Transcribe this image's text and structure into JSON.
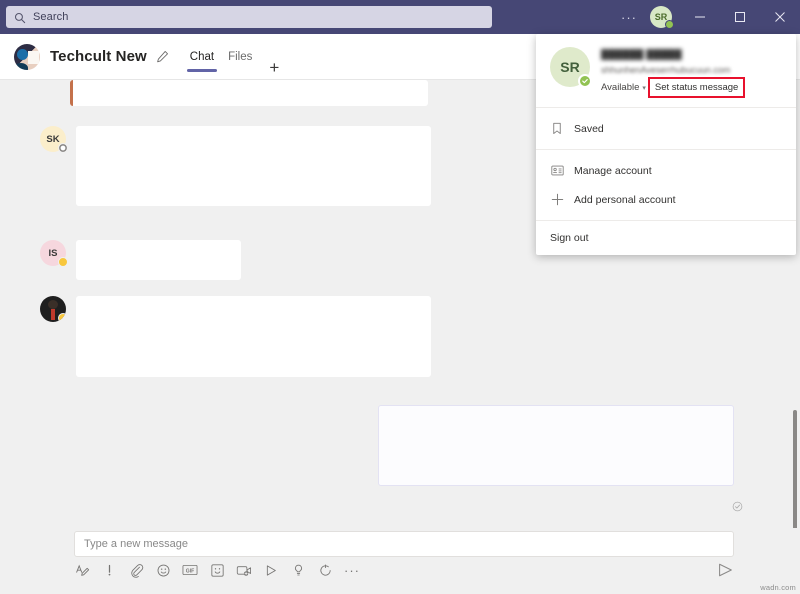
{
  "titlebar": {
    "search_placeholder": "Search",
    "search_icon": "search-icon",
    "more_label": "···",
    "avatar_initials": "SR",
    "presence": "Available",
    "minimize_label": "Minimize",
    "maximize_label": "Maximize",
    "close_label": "Close",
    "accent_color": "#464775"
  },
  "channel": {
    "title": "Techcult New",
    "edit_label": "Edit",
    "tabs": [
      {
        "label": "Chat",
        "active": true
      },
      {
        "label": "Files",
        "active": false
      }
    ],
    "add_tab_label": "+"
  },
  "messages": [
    {
      "sender_initials": "",
      "bubble": "urgent",
      "status": ""
    },
    {
      "sender_initials": "SK",
      "avatar_color": "#fbeecb",
      "status": "offline",
      "status_color": "#8a8886"
    },
    {
      "sender_initials": "IS",
      "avatar_color": "#f6d7de",
      "status": "away",
      "status_color": "#f8c73d"
    },
    {
      "sender_initials": "",
      "avatar_color": "#1f1f1f",
      "status": "away",
      "status_color": "#f8c73d"
    }
  ],
  "outgoing": {
    "seen_icon": "seen-check-icon"
  },
  "compose": {
    "placeholder": "Type a new message",
    "value": "",
    "tools": [
      {
        "name": "format-icon",
        "label": "Format"
      },
      {
        "name": "importance-icon",
        "label": "Set delivery options"
      },
      {
        "name": "attach-icon",
        "label": "Attach"
      },
      {
        "name": "emoji-icon",
        "label": "Emoji"
      },
      {
        "name": "giphy-icon",
        "label": "Giphy"
      },
      {
        "name": "sticker-icon",
        "label": "Sticker"
      },
      {
        "name": "meet-now-icon",
        "label": "Meet now"
      },
      {
        "name": "stream-icon",
        "label": "Stream"
      },
      {
        "name": "praise-icon",
        "label": "Praise"
      },
      {
        "name": "approvals-icon",
        "label": "Approvals"
      },
      {
        "name": "more-options-icon",
        "label": "···"
      }
    ],
    "send_label": "Send"
  },
  "dropdown": {
    "avatar_initials": "SR",
    "name_redacted": "██████ █████",
    "email_redacted": "shhunhenAveserrhubucuun.com",
    "presence_label": "Available",
    "presence_chevron": "▾",
    "set_status_label": "Set status message",
    "saved_label": "Saved",
    "saved_icon": "bookmark-icon",
    "manage_account_label": "Manage account",
    "manage_account_icon": "account-card-icon",
    "add_account_label": "Add personal account",
    "add_account_icon": "plus-icon",
    "sign_out_label": "Sign out",
    "highlight_color": "#e8112d"
  },
  "watermark": {
    "text": "wadn.com"
  }
}
